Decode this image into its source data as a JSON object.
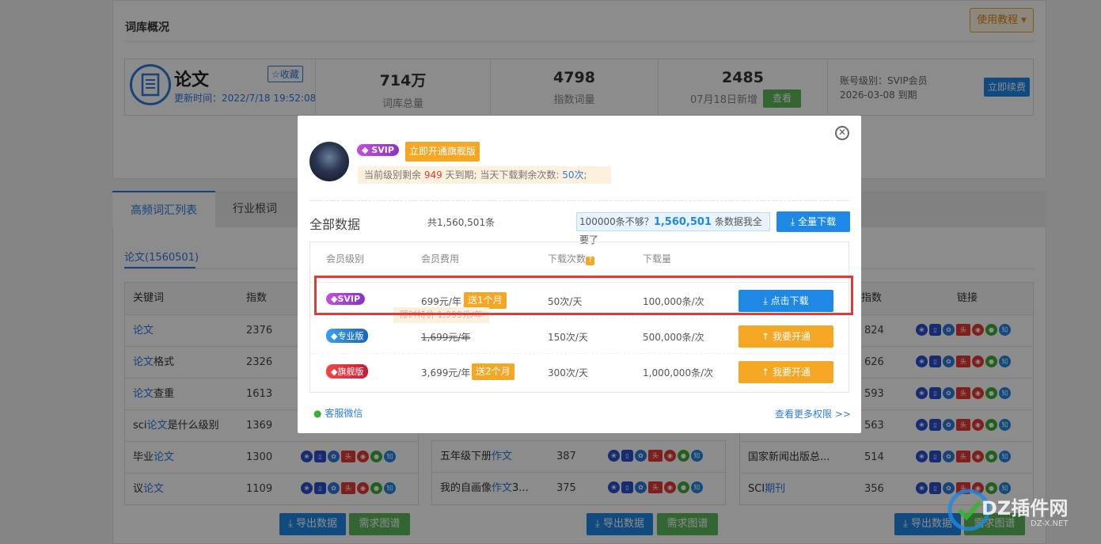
{
  "overview": {
    "section_title": "词库概况",
    "tutorial_button": "使用教程 ▾",
    "doc_title": "论文",
    "favorite_label": "☆收藏",
    "update_time": "更新时间：2022/7/18 19:52:08",
    "stats": [
      {
        "value": "714万",
        "label": "词库总量"
      },
      {
        "value": "4798",
        "label": "指数词量"
      },
      {
        "value": "2485",
        "label": "07月18日新增"
      }
    ],
    "view_button": "查看",
    "account_level": "账号级别：SVIP会员",
    "expire": "2026-03-08 到期",
    "renew_button": "立即续费"
  },
  "tabs": [
    "高频词汇列表",
    "行业根词"
  ],
  "subtab": "论文(1560501)",
  "table_headers": {
    "keyword": "关键词",
    "index": "指数",
    "link": "链接"
  },
  "left_table": [
    {
      "pre": "",
      "hl": "论文",
      "post": "",
      "index": "2376"
    },
    {
      "pre": "",
      "hl": "论文",
      "post": "格式",
      "index": "2326"
    },
    {
      "pre": "",
      "hl": "论文",
      "post": "查重",
      "index": "1613"
    },
    {
      "pre": "sci",
      "hl": "论文",
      "post": "是什么级别",
      "index": "1369"
    },
    {
      "pre": "毕业",
      "hl": "论文",
      "post": "",
      "index": "1300"
    },
    {
      "pre": "议",
      "hl": "论文",
      "post": "",
      "index": "1109"
    }
  ],
  "mid_table": [
    {
      "pre": "五年级下册",
      "hl": "作文",
      "post": "",
      "index": "387"
    },
    {
      "pre": "我的自画像",
      "hl": "作文",
      "post": "3...",
      "index": "375"
    }
  ],
  "right_table": [
    {
      "index": "824"
    },
    {
      "index": "626"
    },
    {
      "index": "593"
    },
    {
      "index": "563"
    },
    {
      "pre": "国家新闻出版总...",
      "hl": "",
      "post": "",
      "index": "514"
    },
    {
      "pre": "SCI",
      "hl": "期刊",
      "post": "",
      "index": "356"
    }
  ],
  "bottom_buttons": {
    "export": "导出数据",
    "ask": "需求图谱"
  },
  "modal": {
    "svip_tag": "SVIP",
    "open_flagship": "立即开通旗舰版",
    "remaining": {
      "pre": "当前级别剩余 ",
      "days": "949",
      "mid": " 天到期;  当天下载剩余次数: ",
      "times": "50次",
      "post": ";"
    },
    "all_data_title": "全部数据",
    "total_count": "共1,560,501条",
    "not_enough": {
      "pre": "100000条不够？",
      "num": "1,560,501",
      "post": " 条数据我全要了"
    },
    "full_download": "全量下载",
    "col_headers": [
      "会员级别",
      "会员费用",
      "下载次数",
      "下载量"
    ],
    "help_mark": "?",
    "plans": [
      {
        "tag": "SVIP",
        "price": "699元/年",
        "promo": "送1个月",
        "times": "50次/天",
        "amount": "100,000条/次",
        "action": "点击下载"
      },
      {
        "tag": "专业版",
        "price": "1,699元/年",
        "promo": "",
        "times": "150次/天",
        "amount": "500,000条/次",
        "action": "我要开通"
      },
      {
        "tag": "旗舰版",
        "price": "3,699元/年",
        "promo": "送2个月",
        "times": "300次/天",
        "amount": "1,000,000条/次",
        "action": "我要开通"
      }
    ],
    "tooltip": "限时特价 1,999元/年",
    "service": "客服微信",
    "more_rights": "查看更多权限 >>"
  },
  "watermark": {
    "brand": "DZ插件网",
    "url": "DZ-X.NET"
  },
  "colors": {
    "blue": "#1e88e5",
    "orange": "#f5a623",
    "red_frame": "#e53935",
    "green": "#5cb85c"
  }
}
